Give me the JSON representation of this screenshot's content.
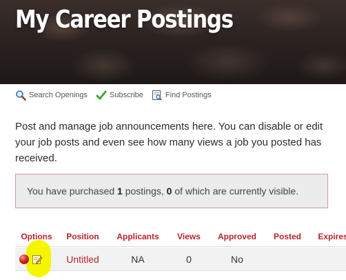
{
  "page": {
    "title": "My Career Postings"
  },
  "toolbar": {
    "items": [
      {
        "label": "Search Openings",
        "icon": "magnifier-icon"
      },
      {
        "label": "Subscribe",
        "icon": "checkmark-icon"
      },
      {
        "label": "Find Postings",
        "icon": "find-document-icon"
      }
    ]
  },
  "intro": {
    "text": "Post and manage job announcements here. You can disable or edit your job posts and even see how many views a job you posted has received."
  },
  "notice": {
    "prefix": "You have purchased ",
    "purchased": "1",
    "middle": " postings, ",
    "visible": "0",
    "suffix": " of which are currently visible."
  },
  "table": {
    "headers": [
      "Options",
      "Position",
      "Applicants",
      "Views",
      "Approved",
      "Posted",
      "Expires"
    ],
    "rows": [
      {
        "position": "Untitled",
        "applicants": "NA",
        "views": "0",
        "approved": "No",
        "posted": "",
        "expires": "",
        "status_icon": "red-status-dot-icon",
        "edit_icon": "edit-pencil-icon"
      }
    ]
  },
  "colors": {
    "accent": "#b8232b",
    "highlight": "#f5f500",
    "notice_border": "#d19a96",
    "notice_bg": "#ececec"
  }
}
